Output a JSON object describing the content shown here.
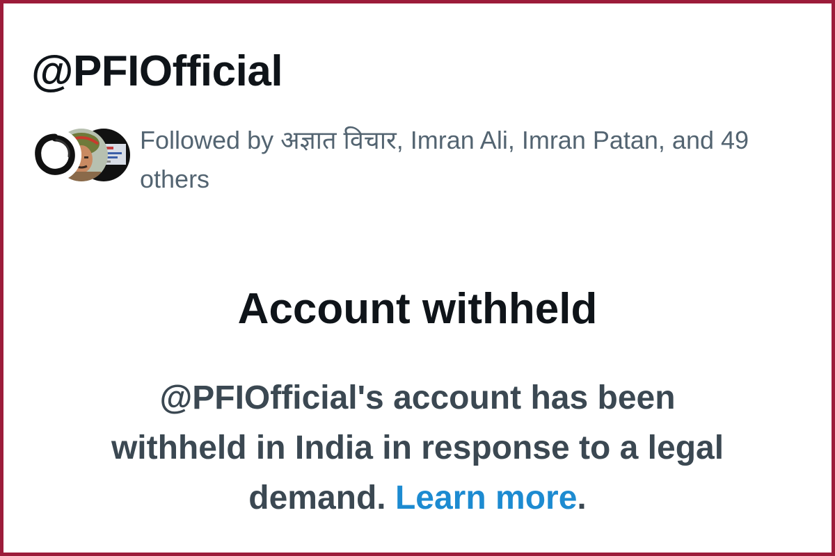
{
  "profile": {
    "handle": "@PFIOfficial"
  },
  "followers_context": {
    "avatars": [
      "brush-circle-avatar",
      "person-turban-avatar",
      "dark-banner-avatar"
    ],
    "text": "Followed by अज्ञात विचार, Imran Ali, Imran Patan, and 49 others"
  },
  "notice": {
    "title": "Account withheld",
    "body_text": "@PFIOfficial's account has been withheld in India in response to a legal demand.",
    "link_label": "Learn more",
    "trailing_punct": "."
  },
  "colors": {
    "frame_border": "#9c1c3a",
    "primary_text": "#0f1419",
    "secondary_text": "#536471",
    "body_text": "#3b4852",
    "link": "#1d8bd1"
  }
}
